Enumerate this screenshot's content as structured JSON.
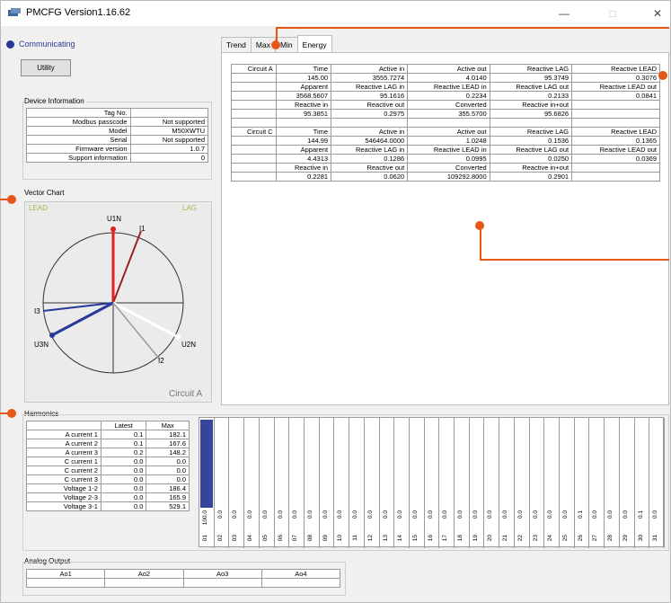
{
  "window": {
    "title": "PMCFG Version1.16.62",
    "minimize": "—",
    "maximize": "□",
    "close": "✕"
  },
  "status": {
    "text": "Communicating",
    "color": "#27399a"
  },
  "utility_label": "Utility",
  "device_info": {
    "label": "Device Information",
    "rows": [
      {
        "k": "Tag No.",
        "v": ""
      },
      {
        "k": "Modbus passcode",
        "v": "Not supported"
      },
      {
        "k": "Model",
        "v": "M50XWTU"
      },
      {
        "k": "Serial",
        "v": "Not supported"
      },
      {
        "k": "Firmware version",
        "v": "1.0.7"
      },
      {
        "k": "Support information",
        "v": "0"
      }
    ]
  },
  "vector_chart": {
    "label": "Vector Chart",
    "lead": "LEAD",
    "lag": "LAG",
    "v1": "U1N",
    "v2": "U2N",
    "v3": "U3N",
    "i1": "I1",
    "i2": "I2",
    "i3": "I3",
    "circuit": "Circuit A",
    "colors": {
      "u1": "#e02020",
      "i1": "#a02020",
      "u3": "#27399a",
      "i3": "#27399a",
      "u2": "#ffffff",
      "i2": "#9a9a9a"
    }
  },
  "tabs": [
    "Trend",
    "Max",
    "Min",
    "Energy"
  ],
  "energy": {
    "circuit_a": {
      "name": "Circuit A",
      "rows": [
        [
          "Time",
          "Active in",
          "Active out",
          "Reactive LAG",
          "Reactive LEAD"
        ],
        [
          "145.00",
          "3555.7274",
          "4.0140",
          "95.3749",
          "0.3076"
        ],
        [
          "Apparent",
          "Reactive LAG in",
          "Reactive LEAD in",
          "Reactive LAG out",
          "Reactive LEAD out"
        ],
        [
          "3568.5607",
          "95.1616",
          "0.2234",
          "0.2133",
          "0.0841"
        ],
        [
          "Reactive in",
          "Reactive out",
          "Converted",
          "Reactive in+out",
          ""
        ],
        [
          "95.3851",
          "0.2975",
          "355.5700",
          "95.6826",
          ""
        ]
      ]
    },
    "circuit_c": {
      "name": "Circuit C",
      "rows": [
        [
          "Time",
          "Active in",
          "Active out",
          "Reactive LAG",
          "Reactive LEAD"
        ],
        [
          "144.99",
          "546464.0000",
          "1.0248",
          "0.1536",
          "0.1365"
        ],
        [
          "Apparent",
          "Reactive LAG in",
          "Reactive LEAD in",
          "Reactive LAG out",
          "Reactive LEAD out"
        ],
        [
          "4.4313",
          "0.1286",
          "0.0995",
          "0.0250",
          "0.0369"
        ],
        [
          "Reactive in",
          "Reactive out",
          "Converted",
          "Reactive in+out",
          ""
        ],
        [
          "0.2281",
          "0.0620",
          "109292.8000",
          "0.2901",
          ""
        ]
      ]
    }
  },
  "harmonics": {
    "label": "Harmonics",
    "headers": [
      "",
      "Latest",
      "Max"
    ],
    "rows": [
      [
        "A current 1",
        "0.1",
        "182.1"
      ],
      [
        "A current 2",
        "0.1",
        "167.6"
      ],
      [
        "A current 3",
        "0.2",
        "148.2"
      ],
      [
        "C current 1",
        "0.0",
        "0.0"
      ],
      [
        "C current 2",
        "0.0",
        "0.0"
      ],
      [
        "C current 3",
        "0.0",
        "0.0"
      ],
      [
        "Voltage 1-2",
        "0.0",
        "186.4"
      ],
      [
        "Voltage 2-3",
        "0.0",
        "165.9"
      ],
      [
        "Voltage 3-1",
        "0.0",
        "529.1"
      ]
    ],
    "bars": [
      {
        "n": "01",
        "v": "100.0"
      },
      {
        "n": "02",
        "v": "0.0"
      },
      {
        "n": "03",
        "v": "0.0"
      },
      {
        "n": "04",
        "v": "0.0"
      },
      {
        "n": "05",
        "v": "0.0"
      },
      {
        "n": "06",
        "v": "0.0"
      },
      {
        "n": "07",
        "v": "0.0"
      },
      {
        "n": "08",
        "v": "0.0"
      },
      {
        "n": "09",
        "v": "0.0"
      },
      {
        "n": "10",
        "v": "0.0"
      },
      {
        "n": "11",
        "v": "0.0"
      },
      {
        "n": "12",
        "v": "0.0"
      },
      {
        "n": "13",
        "v": "0.0"
      },
      {
        "n": "14",
        "v": "0.0"
      },
      {
        "n": "15",
        "v": "0.0"
      },
      {
        "n": "16",
        "v": "0.0"
      },
      {
        "n": "17",
        "v": "0.0"
      },
      {
        "n": "18",
        "v": "0.0"
      },
      {
        "n": "19",
        "v": "0.0"
      },
      {
        "n": "20",
        "v": "0.0"
      },
      {
        "n": "21",
        "v": "0.0"
      },
      {
        "n": "22",
        "v": "0.0"
      },
      {
        "n": "23",
        "v": "0.0"
      },
      {
        "n": "24",
        "v": "0.0"
      },
      {
        "n": "25",
        "v": "0.0"
      },
      {
        "n": "26",
        "v": "0.1"
      },
      {
        "n": "27",
        "v": "0.0"
      },
      {
        "n": "28",
        "v": "0.0"
      },
      {
        "n": "29",
        "v": "0.0"
      },
      {
        "n": "30",
        "v": "0.1"
      },
      {
        "n": "31",
        "v": "0.0"
      }
    ],
    "bar_color": "#36449a"
  },
  "analog": {
    "label": "Analog Output",
    "headers": [
      "Ao1",
      "Ao2",
      "Ao3",
      "Ao4"
    ]
  },
  "annotation_color": "#e65717"
}
